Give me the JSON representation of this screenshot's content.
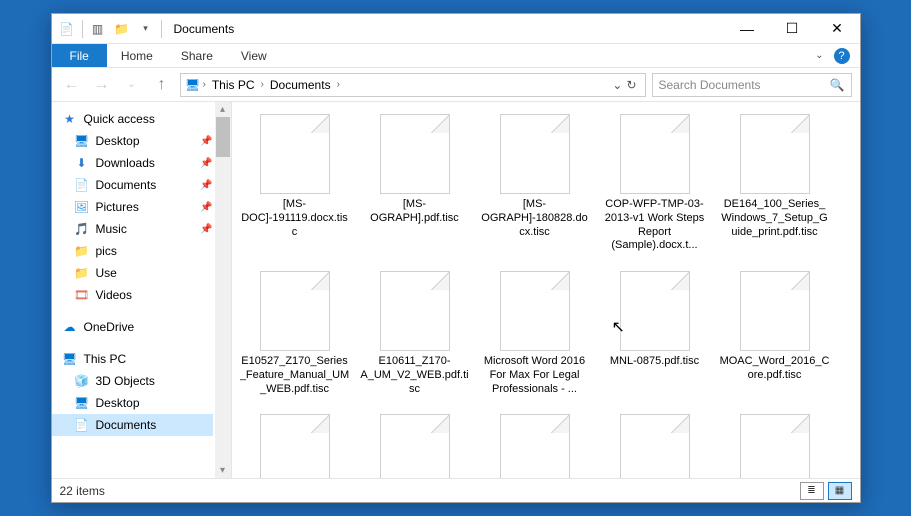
{
  "window": {
    "title": "Documents"
  },
  "ribbon": {
    "file": "File",
    "tabs": [
      "Home",
      "Share",
      "View"
    ]
  },
  "nav": {
    "up_tooltip": "Up"
  },
  "breadcrumb": {
    "root_icon": "pc",
    "parts": [
      "This PC",
      "Documents"
    ]
  },
  "search": {
    "placeholder": "Search Documents"
  },
  "sidebar": {
    "quick_access": {
      "label": "Quick access",
      "items": [
        {
          "label": "Desktop",
          "icon": "monitor",
          "pinned": true
        },
        {
          "label": "Downloads",
          "icon": "down",
          "pinned": true
        },
        {
          "label": "Documents",
          "icon": "doc",
          "pinned": true
        },
        {
          "label": "Pictures",
          "icon": "pic",
          "pinned": true
        },
        {
          "label": "Music",
          "icon": "music",
          "pinned": true
        },
        {
          "label": "pics",
          "icon": "folder",
          "pinned": false
        },
        {
          "label": "Use",
          "icon": "folder",
          "pinned": false
        },
        {
          "label": "Videos",
          "icon": "video",
          "pinned": false
        }
      ]
    },
    "onedrive": {
      "label": "OneDrive"
    },
    "this_pc": {
      "label": "This PC",
      "items": [
        {
          "label": "3D Objects",
          "icon": "3d"
        },
        {
          "label": "Desktop",
          "icon": "monitor"
        },
        {
          "label": "Documents",
          "icon": "doc",
          "selected": true
        }
      ]
    }
  },
  "files": [
    {
      "name": "[MS-DOC]-191119.docx.tisc"
    },
    {
      "name": "[MS-OGRAPH].pdf.tisc"
    },
    {
      "name": "[MS-OGRAPH]-180828.docx.tisc"
    },
    {
      "name": "COP-WFP-TMP-03-2013-v1 Work Steps Report (Sample).docx.t..."
    },
    {
      "name": "DE164_100_Series_Windows_7_Setup_Guide_print.pdf.tisc"
    },
    {
      "name": "E10527_Z170_Series_Feature_Manual_UM_WEB.pdf.tisc"
    },
    {
      "name": "E10611_Z170-A_UM_V2_WEB.pdf.tisc"
    },
    {
      "name": "Microsoft Word 2016 For Max For Legal Professionals - ..."
    },
    {
      "name": "MNL-0875.pdf.tisc"
    },
    {
      "name": "MOAC_Word_2016_Core.pdf.tisc"
    },
    {
      "name": ""
    },
    {
      "name": ""
    },
    {
      "name": ""
    },
    {
      "name": ""
    },
    {
      "name": ""
    }
  ],
  "status": {
    "count_label": "22 items"
  }
}
